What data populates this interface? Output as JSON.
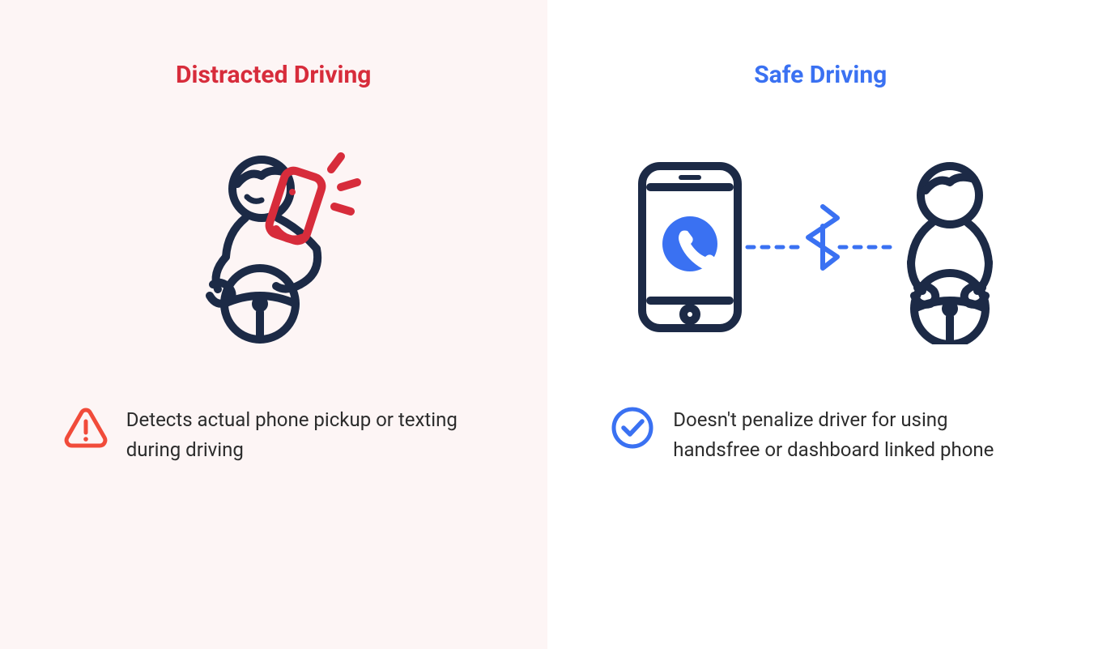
{
  "left": {
    "title": "Distracted Driving",
    "desc": "Detects actual phone pickup or texting during driving"
  },
  "right": {
    "title": "Safe Driving",
    "desc": "Doesn't penalize driver for using handsfree or dashboard linked phone"
  },
  "colors": {
    "red": "#d72c3b",
    "orange": "#f14b3a",
    "blue": "#3a71f2",
    "navy": "#1c2a46"
  }
}
